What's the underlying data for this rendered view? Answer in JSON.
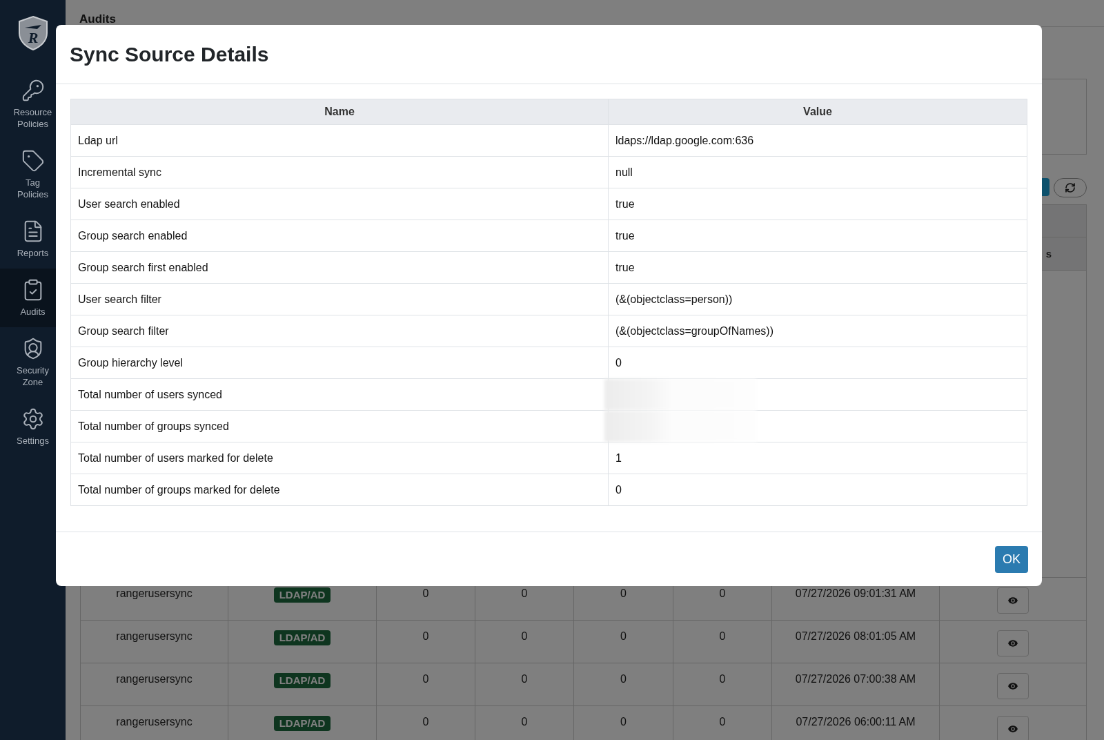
{
  "sidebar": {
    "logo_letter": "R",
    "items": [
      {
        "label": "Resource Policies",
        "selected": false
      },
      {
        "label": "Tag Policies",
        "selected": false
      },
      {
        "label": "Reports",
        "selected": false
      },
      {
        "label": "Audits",
        "selected": true
      },
      {
        "label": "Security Zone",
        "selected": false
      },
      {
        "label": "Settings",
        "selected": false
      }
    ]
  },
  "page": {
    "title": "Audits",
    "header_fragment": "s",
    "rows": [
      {
        "user": "rangerusersync",
        "source": "LDAP/AD",
        "column_3": "0",
        "column_4": "0",
        "column_5": "0",
        "column_6": "0",
        "time": "07/27/2026 09:01:31 AM"
      },
      {
        "user": "rangerusersync",
        "source": "LDAP/AD",
        "column_3": "0",
        "column_4": "0",
        "column_5": "0",
        "column_6": "0",
        "time": "07/27/2026 08:01:05 AM"
      },
      {
        "user": "rangerusersync",
        "source": "LDAP/AD",
        "column_3": "0",
        "column_4": "0",
        "column_5": "0",
        "column_6": "0",
        "time": "07/27/2026 07:00:38 AM"
      },
      {
        "user": "rangerusersync",
        "source": "LDAP/AD",
        "column_3": "0",
        "column_4": "0",
        "column_5": "0",
        "column_6": "0",
        "time": "07/27/2026 06:00:11 AM"
      }
    ]
  },
  "modal": {
    "title": "Sync Source Details",
    "columns": [
      "Name",
      "Value"
    ],
    "rows": [
      {
        "name": "Ldap url",
        "value": "ldaps://ldap.google.com:636",
        "redacted": false
      },
      {
        "name": "Incremental sync",
        "value": "null",
        "redacted": false
      },
      {
        "name": "User search enabled",
        "value": "true",
        "redacted": false
      },
      {
        "name": "Group search enabled",
        "value": "true",
        "redacted": false
      },
      {
        "name": "Group search first enabled",
        "value": "true",
        "redacted": false
      },
      {
        "name": "User search filter",
        "value": "(&(objectclass=person))",
        "redacted": false
      },
      {
        "name": "Group search filter",
        "value": "(&(objectclass=groupOfNames))",
        "redacted": false
      },
      {
        "name": "Group hierarchy level",
        "value": "0",
        "redacted": false
      },
      {
        "name": "Total number of users synced",
        "redacted": true
      },
      {
        "name": "Total number of groups synced",
        "redacted": true
      },
      {
        "name": "Total number of users marked for delete",
        "value": "1",
        "redacted": false
      },
      {
        "name": "Total number of groups marked for delete",
        "value": "0",
        "redacted": false
      }
    ],
    "button": "OK"
  }
}
